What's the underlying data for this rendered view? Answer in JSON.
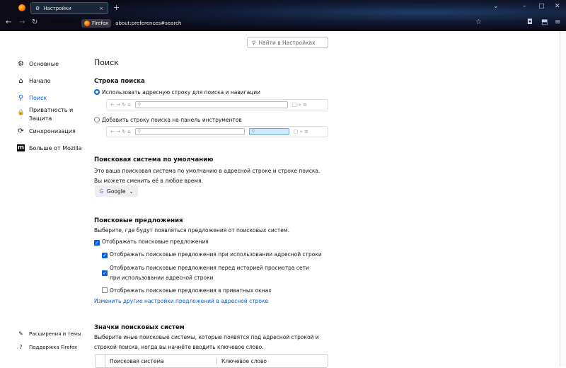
{
  "tab": {
    "title": "Настройки",
    "close": "×",
    "new_tab": "+"
  },
  "window": {
    "list": "⌄",
    "minimize": "–",
    "maximize": "□",
    "close": "✕"
  },
  "nav": {
    "back": "←",
    "forward": "→",
    "reload": "↻",
    "identity": "Firefox",
    "url": "about:preferences#search",
    "star": "☆",
    "pocket": "◘",
    "extensions": "⬒",
    "menu": "≡"
  },
  "search_placeholder": "Найти в Настройках",
  "sidebar": [
    {
      "icon": "⚙",
      "label": "Основные"
    },
    {
      "icon": "⌂",
      "label": "Начало"
    },
    {
      "icon": "⚲",
      "label": "Поиск"
    },
    {
      "icon": "🔒",
      "label": "Приватность и Защита"
    },
    {
      "icon": "⟳",
      "label": "Синхронизация"
    },
    {
      "icon": "m",
      "label": "Больше от Mozilla"
    }
  ],
  "sidebar_bottom": [
    {
      "icon": "✎",
      "label": "Расширения и темы"
    },
    {
      "icon": "?",
      "label": "Поддержка Firefox"
    }
  ],
  "page_title": "Поиск",
  "search_bar": {
    "heading": "Строка поиска",
    "option1": "Использовать адресную строку для поиска и навигации",
    "option2": "Добавить строку поиска на панель инструментов",
    "selected": "option1"
  },
  "default_engine": {
    "heading": "Поисковая система по умолчанию",
    "desc": "Это ваша поисковая система по умолчанию в адресной строке и строке поиска. Вы можете сменить её в любое время.",
    "value": "Google",
    "g": "G"
  },
  "suggestions": {
    "heading": "Поисковые предложения",
    "desc": "Выберите, где будут появляться предложения от поисковых систем.",
    "show": "Отображать поисковые предложения",
    "urlbar": "Отображать поисковые предложения при использовании адресной строки",
    "before_history": "Отображать поисковые предложения перед историей просмотра сети при использовании адресной строки",
    "private": "Отображать поисковые предложения в приватных окнах",
    "link": "Изменить другие настройки предложений в адресной строке",
    "checked": [
      true,
      true,
      true,
      false
    ]
  },
  "shortcuts": {
    "heading": "Значки поисковых систем",
    "desc": "Выберите иные поисковые системы, которые появятся под адресной строкой и строкой поиска, когда вы начнёте вводить ключевое слово.",
    "col1": "Поисковая система",
    "col2": "Ключевое слово"
  }
}
